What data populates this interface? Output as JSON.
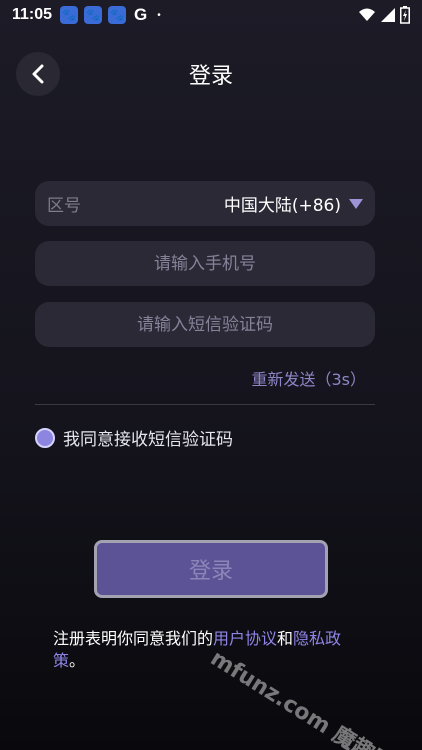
{
  "status": {
    "time": "11:05",
    "g_label": "G",
    "dot": "•"
  },
  "header": {
    "title": "登录"
  },
  "region": {
    "label": "区号",
    "value": "中国大陆(+86)"
  },
  "phone": {
    "placeholder": "请输入手机号",
    "value": ""
  },
  "code": {
    "placeholder": "请输入短信验证码",
    "value": ""
  },
  "resend": {
    "label": "重新发送（3s）"
  },
  "agree": {
    "label": "我同意接收短信验证码",
    "checked": true
  },
  "login_button": {
    "label": "登录"
  },
  "terms": {
    "prefix": "注册表明你同意我们的",
    "user_agreement": "用户协议",
    "and": "和",
    "privacy_policy": "隐私政策",
    "suffix": "。"
  },
  "watermark": {
    "text": "mfunz.com 魔趣网"
  },
  "colors": {
    "accent": "#8e85e6",
    "button_bg": "#5b5396",
    "field_bg": "#2b2935"
  },
  "icons": {
    "back": "chevron-left-icon",
    "dropdown": "caret-down-icon",
    "wifi": "wifi-icon",
    "signal": "signal-icon",
    "battery": "battery-icon"
  }
}
